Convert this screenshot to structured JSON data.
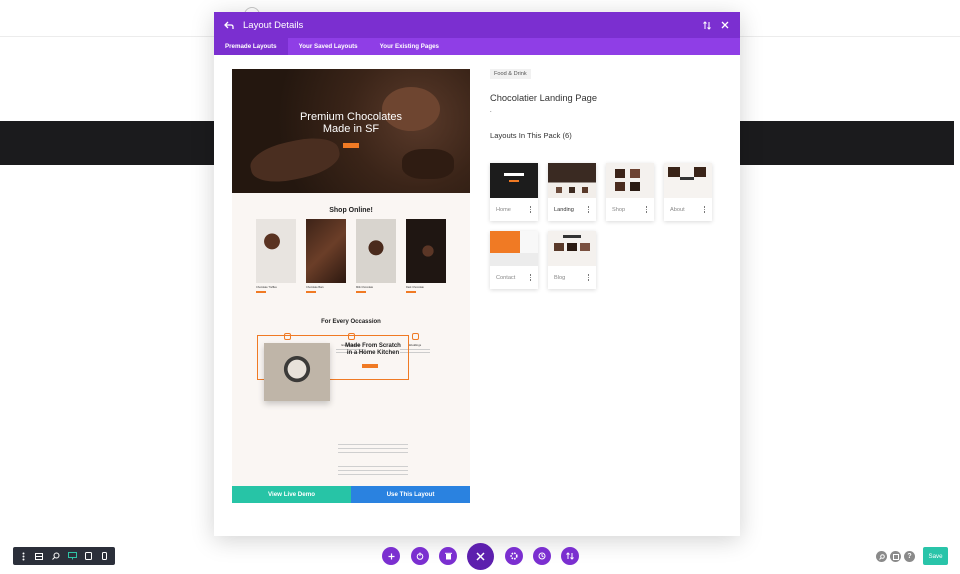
{
  "modal": {
    "title": "Layout Details",
    "tabs": [
      {
        "label": "Premade Layouts",
        "active": true
      },
      {
        "label": "Your Saved Layouts",
        "active": false
      },
      {
        "label": "Your Existing Pages",
        "active": false
      }
    ]
  },
  "preview": {
    "hero_title_line1": "Premium Chocolates",
    "hero_title_line2": "Made in SF",
    "shop_title": "Shop Online!",
    "products": [
      "Chocolate Truffles",
      "Chocolate Bars",
      "Milk Chocolate",
      "Dark Chocolate"
    ],
    "occasion_title": "For Every Occassion",
    "occasions": [
      "Birthday Gifts",
      "Event Desserts",
      "Weddings"
    ],
    "kitchen_title_line1": "Made From Scratch",
    "kitchen_title_line2": "in a Home Kitchen",
    "view_demo_label": "View Live Demo",
    "use_layout_label": "Use This Layout"
  },
  "details": {
    "category": "Food & Drink",
    "layout_name": "Chocolatier Landing Page",
    "separator": ".",
    "pack_title": "Layouts In This Pack (6)",
    "layouts": [
      {
        "label": "Home"
      },
      {
        "label": "Landing"
      },
      {
        "label": "Shop"
      },
      {
        "label": "About"
      },
      {
        "label": "Contact"
      },
      {
        "label": "Blog"
      }
    ]
  },
  "bottom": {
    "save_label": "Save"
  },
  "colors": {
    "accent_purple": "#7b2fd0",
    "tab_purple": "#8f3ee6",
    "teal": "#27c4a6",
    "blue": "#2a82e0",
    "orange": "#f07a24"
  }
}
